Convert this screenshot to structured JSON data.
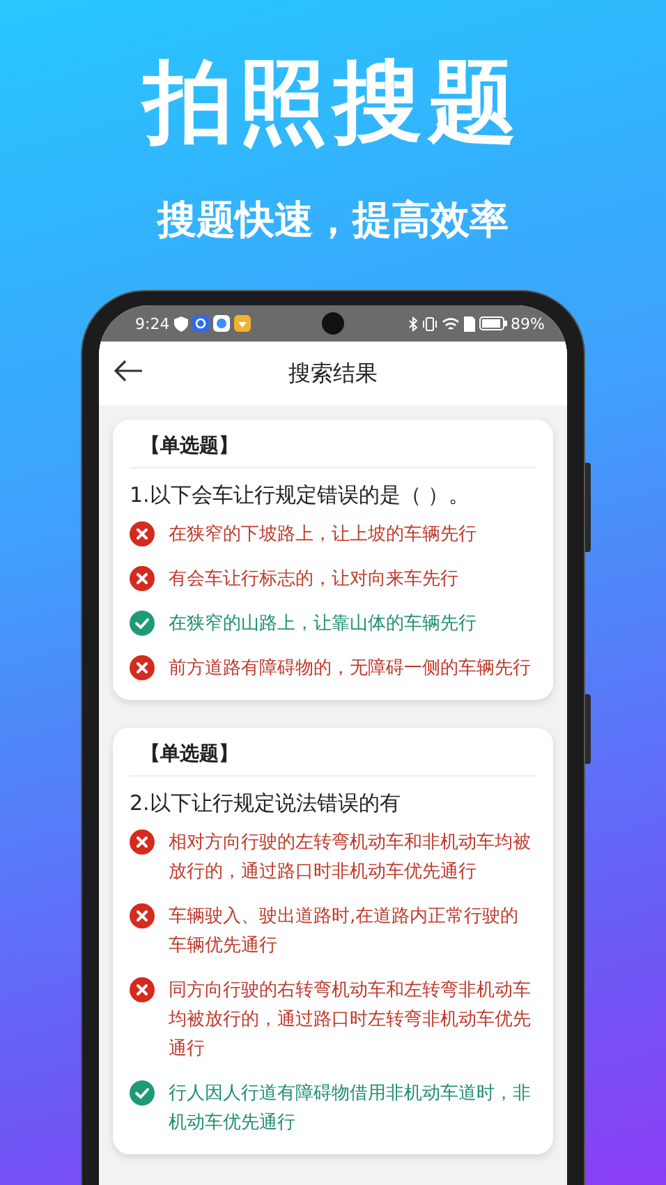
{
  "promo": {
    "headline": "拍照搜题",
    "subtitle": "搜题快速，提高效率"
  },
  "status_bar": {
    "time": "9:24",
    "battery": "89%"
  },
  "app_bar": {
    "title": "搜索结果"
  },
  "questions": [
    {
      "tag": "【单选题】",
      "text": "1.以下会车让行规定错误的是（ ）。",
      "options": [
        {
          "kind": "wrong",
          "text": "在狭窄的下坡路上，让上坡的车辆先行"
        },
        {
          "kind": "wrong",
          "text": "有会车让行标志的，让对向来车先行"
        },
        {
          "kind": "correct",
          "text": "在狭窄的山路上，让靠山体的车辆先行"
        },
        {
          "kind": "wrong",
          "text": "前方道路有障碍物的，无障碍一侧的车辆先行"
        }
      ]
    },
    {
      "tag": "【单选题】",
      "text": "2.以下让行规定说法错误的有",
      "options": [
        {
          "kind": "wrong",
          "text": "相对方向行驶的左转弯机动车和非机动车均被放行的，通过路口时非机动车优先通行"
        },
        {
          "kind": "wrong",
          "text": "车辆驶入、驶出道路时,在道路内正常行驶的车辆优先通行"
        },
        {
          "kind": "wrong",
          "text": "同方向行驶的右转弯机动车和左转弯非机动车均被放行的，通过路口时左转弯非机动车优先通行"
        },
        {
          "kind": "correct",
          "text": "行人因人行道有障碍物借用非机动车道时，非机动车优先通行"
        }
      ]
    }
  ]
}
